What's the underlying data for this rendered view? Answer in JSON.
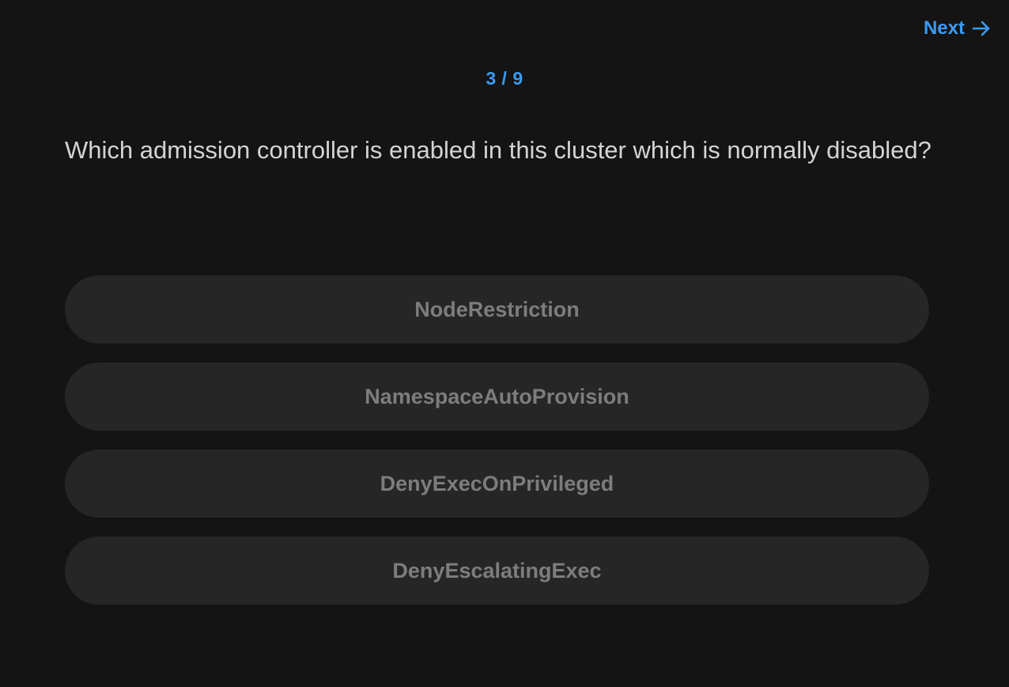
{
  "header": {
    "next_label": "Next",
    "next_icon": "arrow-right-icon"
  },
  "progress": {
    "text": "3 / 9",
    "current": 3,
    "total": 9
  },
  "question": {
    "text": "Which admission controller is enabled in this cluster which is normally disabled?"
  },
  "options": [
    {
      "label": "NodeRestriction"
    },
    {
      "label": "NamespaceAutoProvision"
    },
    {
      "label": "DenyExecOnPrivileged"
    },
    {
      "label": "DenyEscalatingExec"
    }
  ],
  "colors": {
    "background": "#141414",
    "accent": "#3a9cf5",
    "question_text": "#d4d4d4",
    "option_bg": "#262626",
    "option_text": "#7d7d7d"
  }
}
